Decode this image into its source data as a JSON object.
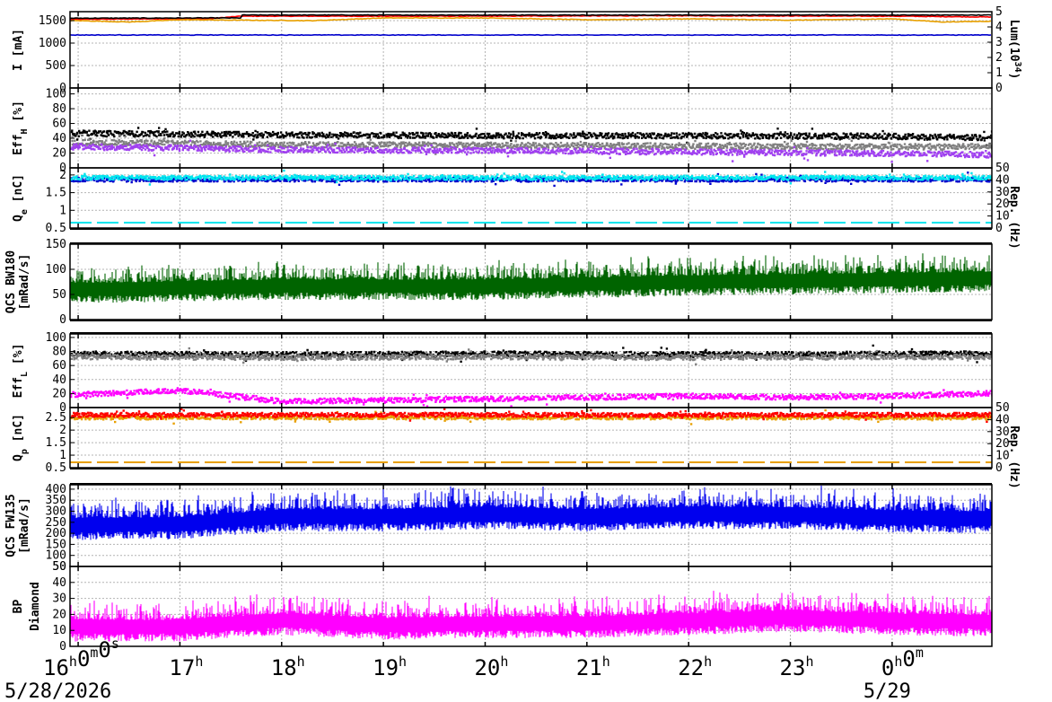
{
  "chart_data": {
    "type": "line",
    "time_axis": {
      "ticks": [
        {
          "major": "16",
          "sup": "h",
          "rest": "0",
          "sup2": "m",
          "rest2": "0",
          "sup3": "s"
        },
        {
          "major": "17",
          "sup": "h"
        },
        {
          "major": "18",
          "sup": "h"
        },
        {
          "major": "19",
          "sup": "h"
        },
        {
          "major": "20",
          "sup": "h"
        },
        {
          "major": "21",
          "sup": "h"
        },
        {
          "major": "22",
          "sup": "h"
        },
        {
          "major": "23",
          "sup": "h"
        },
        {
          "major": "0",
          "sup": "h",
          "rest": "0",
          "sup2": "m"
        }
      ],
      "tick_hours": [
        16,
        17,
        18,
        19,
        20,
        21,
        22,
        23,
        24
      ],
      "range_hours": [
        15.92,
        24.98
      ],
      "dates": [
        {
          "label": "5/28/2026",
          "hour": 15.6
        },
        {
          "label": "5/29",
          "hour": 24.0
        }
      ]
    },
    "panels": [
      {
        "id": "current",
        "ylabel": "I [mA]",
        "ylim": [
          0,
          1700
        ],
        "yticks": [
          0,
          500,
          1000,
          1500
        ],
        "right_label": "Lum(10^34)",
        "right_ylim": [
          0,
          5
        ],
        "right_yticks": [
          0,
          1,
          2,
          3,
          4,
          5
        ],
        "series": [
          {
            "color": "#ff0000",
            "style": "line",
            "x": [
              16.0,
              17.3,
              17.6,
              20.0,
              21.7,
              24.0,
              25.0
            ],
            "y": [
              1530,
              1545,
              1600,
              1600,
              1610,
              1600,
              1580
            ]
          },
          {
            "color": "#000000",
            "style": "line",
            "x": [
              16.0,
              17.6,
              17.61,
              25.0
            ],
            "y": [
              1555,
              1560,
              1625,
              1625
            ]
          },
          {
            "color": "#e8a000",
            "style": "line",
            "x": [
              16.0,
              16.5,
              17.0,
              18.3,
              19.0,
              20.0,
              21.0,
              22.0,
              23.0,
              24.0,
              24.5,
              25.0
            ],
            "y": [
              1500,
              1470,
              1520,
              1500,
              1560,
              1560,
              1520,
              1540,
              1510,
              1540,
              1470,
              1490
            ]
          },
          {
            "color": "#0000cc",
            "style": "line",
            "x": [
              16.0,
              25.0
            ],
            "y": [
              1180,
              1180
            ]
          }
        ]
      },
      {
        "id": "effh",
        "ylabel": "Eff_H [%]",
        "ylim": [
          0,
          108
        ],
        "yticks": [
          0,
          20,
          40,
          60,
          80,
          100
        ],
        "series": [
          {
            "color": "#000000",
            "style": "scatter",
            "x": [
              16.0,
              18.0,
              20.0,
              22.0,
              24.0,
              25.0
            ],
            "y": [
              48,
              46,
              45,
              45,
              44,
              42
            ]
          },
          {
            "color": "#808080",
            "style": "scatter",
            "x": [
              16.0,
              18.0,
              20.0,
              22.0,
              24.0,
              25.0
            ],
            "y": [
              36,
              33,
              32,
              31,
              30,
              30
            ]
          },
          {
            "color": "#a040f0",
            "style": "scatter",
            "x": [
              16.0,
              18.0,
              20.0,
              22.0,
              24.0,
              25.0
            ],
            "y": [
              30,
              26,
              25,
              23,
              21,
              19
            ]
          }
        ]
      },
      {
        "id": "qe",
        "ylabel": "Q_e [nC]",
        "ylim": [
          0.5,
          2.2
        ],
        "yticks": [
          0.5,
          1,
          1.5,
          2
        ],
        "right_label": "Rep. (Hz)",
        "right_ylim": [
          0,
          50
        ],
        "right_yticks": [
          0,
          10,
          20,
          30,
          40,
          50
        ],
        "series": [
          {
            "color": "#0000cc",
            "style": "scatter",
            "x": [
              16.0,
              25.0
            ],
            "y": [
              1.9,
              1.9
            ]
          },
          {
            "color": "#00e5ee",
            "style": "scatter",
            "x": [
              16.0,
              25.0
            ],
            "y": [
              1.95,
              1.95
            ]
          }
        ]
      },
      {
        "id": "bw180",
        "ylabel": "QCS BW180 [mRad/s]",
        "ylim": [
          0,
          150
        ],
        "yticks": [
          0,
          50,
          100,
          150
        ],
        "series": [
          {
            "color": "#006400",
            "style": "band",
            "x": [
              16.0,
              18.0,
              20.0,
              22.0,
              24.0,
              25.0
            ],
            "y": [
              65,
              72,
              72,
              80,
              85,
              88
            ]
          }
        ]
      },
      {
        "id": "effl",
        "ylabel": "Eff_L [%]",
        "ylim": [
          0,
          105
        ],
        "yticks": [
          0,
          20,
          40,
          60,
          80,
          100
        ],
        "series": [
          {
            "color": "#000000",
            "style": "scatter",
            "x": [
              16.0,
              18.0,
              20.0,
              22.0,
              24.0,
              25.0
            ],
            "y": [
              78,
              77,
              78,
              77,
              78,
              78
            ]
          },
          {
            "color": "#808080",
            "style": "scatter",
            "x": [
              16.0,
              18.0,
              20.0,
              22.0,
              24.0,
              25.0
            ],
            "y": [
              74,
              73,
              74,
              73,
              74,
              74
            ]
          },
          {
            "color": "#ff00ff",
            "style": "scatter",
            "x": [
              16.0,
              17.0,
              18.0,
              19.0,
              20.0,
              21.0,
              22.0,
              23.0,
              24.0,
              25.0
            ],
            "y": [
              20,
              26,
              10,
              12,
              14,
              16,
              18,
              16,
              18,
              22
            ]
          }
        ]
      },
      {
        "id": "qp",
        "ylabel": "Q_p [nC]",
        "ylim": [
          0.5,
          2.9
        ],
        "yticks": [
          0.5,
          1,
          1.5,
          2,
          2.5
        ],
        "right_label": "Rep. (Hz)",
        "right_ylim": [
          0,
          50
        ],
        "right_yticks": [
          0,
          10,
          20,
          30,
          40,
          50
        ],
        "series": [
          {
            "color": "#e8a000",
            "style": "scatter",
            "x": [
              16.0,
              25.0
            ],
            "y": [
              2.55,
              2.55
            ]
          },
          {
            "color": "#ff0000",
            "style": "scatter",
            "x": [
              16.0,
              25.0
            ],
            "y": [
              2.65,
              2.65
            ]
          }
        ]
      },
      {
        "id": "fw135",
        "ylabel": "QCS FW135 [mRad/s]",
        "ylim": [
          50,
          420
        ],
        "yticks": [
          50,
          100,
          150,
          200,
          250,
          300,
          350,
          400
        ],
        "series": [
          {
            "color": "#0000ee",
            "style": "band",
            "x": [
              16.0,
              17.0,
              18.0,
              19.0,
              20.0,
              21.0,
              22.0,
              23.0,
              24.0,
              25.0
            ],
            "y": [
              250,
              255,
              290,
              290,
              300,
              290,
              300,
              300,
              285,
              280
            ]
          }
        ]
      },
      {
        "id": "bp",
        "ylabel": "BP Diamond",
        "ylim": [
          0,
          50
        ],
        "yticks": [
          0,
          10,
          20,
          30,
          40,
          50
        ],
        "series": [
          {
            "color": "#ff00ff",
            "style": "band",
            "x": [
              16.0,
              17.0,
              18.0,
              19.0,
              20.0,
              21.0,
              22.0,
              23.0,
              24.0,
              25.0
            ],
            "y": [
              14,
              14,
              18,
              15,
              16,
              16,
              18,
              20,
              18,
              17
            ]
          }
        ]
      }
    ]
  }
}
